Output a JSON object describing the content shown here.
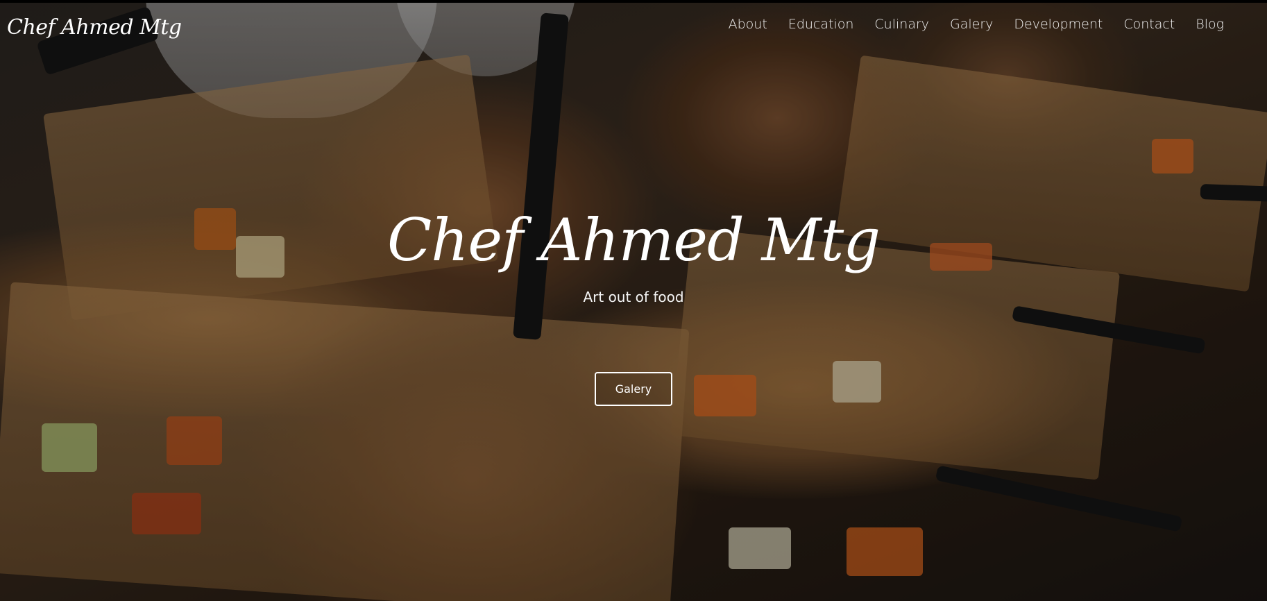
{
  "brand": {
    "name": "Chef Ahmed Mtg"
  },
  "nav": {
    "items": [
      {
        "label": "About"
      },
      {
        "label": "Education"
      },
      {
        "label": "Culinary"
      },
      {
        "label": "Galery"
      },
      {
        "label": "Development"
      },
      {
        "label": "Contact"
      },
      {
        "label": "Blog"
      }
    ]
  },
  "hero": {
    "title": "Chef Ahmed Mtg",
    "subtitle": "Art out of food",
    "button_label": "Galery",
    "background_image": "roasted meat wellingtons with roasted vegetables on wooden cutting boards"
  },
  "colors": {
    "text": "#ffffff",
    "overlay": "rgba(0,0,0,0.28)"
  }
}
